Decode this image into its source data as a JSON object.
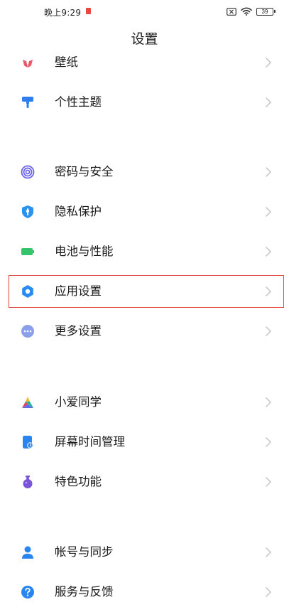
{
  "status_bar": {
    "time": "晚上9:29",
    "battery": "39"
  },
  "header": {
    "title": "设置"
  },
  "settings": {
    "wallpaper": "壁纸",
    "theme": "个性主题",
    "password_security": "密码与安全",
    "privacy": "隐私保护",
    "battery_performance": "电池与性能",
    "app_settings": "应用设置",
    "more_settings": "更多设置",
    "xiaoai": "小爱同学",
    "screen_time": "屏幕时间管理",
    "special_features": "特色功能",
    "account_sync": "帐号与同步",
    "service_feedback": "服务与反馈"
  },
  "colors": {
    "highlight": "#e0463a",
    "wallpaper_icon": "#e85a6b",
    "theme_icon": "#2f7ff0",
    "security_icon": "#6a62e8",
    "privacy_icon": "#2a92f0",
    "battery_icon": "#35c46a",
    "app_settings_icon": "#2a8bf0",
    "more_icon": "#8aa0ea",
    "screen_time_icon": "#2a86ef",
    "special_icon": "#7a55d8",
    "account_icon": "#2a86ef",
    "service_icon": "#2a86ef"
  }
}
